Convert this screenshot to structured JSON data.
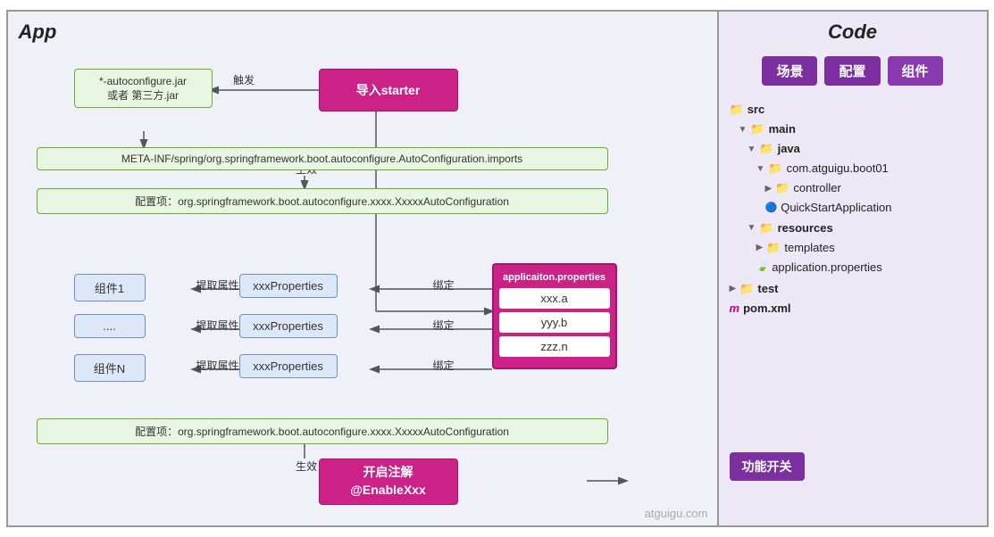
{
  "app": {
    "title": "App",
    "jar_box": "*-autoconfigure.jar\n或者 第三方.jar",
    "meta_inf": "META-INF/spring/org.springframework.boot.autoconfigure.AutoConfiguration.imports",
    "config1": "配置项：org.springframework.boot.autoconfigure.xxxx.XxxxxAutoConfiguration",
    "config2": "配置项：org.springframework.boot.autoconfigure.xxxx.XxxxxAutoConfiguration",
    "trigger": "导入starter",
    "trigger_arrow": "触发",
    "effect1": "生效",
    "effect2": "生效",
    "component1": "组件1",
    "component_dots": "....",
    "componentN": "组件N",
    "props1": "xxxProperties",
    "props2": "xxxProperties",
    "props3": "xxxProperties",
    "extract1": "提取属性",
    "extract2": "提取属性",
    "extract3": "提取属性",
    "bind1": "绑定",
    "bind2": "绑定",
    "bind3": "绑定",
    "app_properties_title": "applicaiton.properties",
    "prop_a": "xxx.a",
    "prop_b": "yyy.b",
    "prop_n": "zzz.n",
    "enable_box": "开启注解\n@EnableXxx",
    "func_btn": "功能开关"
  },
  "code": {
    "title": "Code",
    "btn_scene": "场景",
    "btn_config": "配置",
    "btn_component": "组件",
    "tree": [
      {
        "indent": 0,
        "icon": "folder",
        "label": "src"
      },
      {
        "indent": 1,
        "icon": "arrow",
        "label": ""
      },
      {
        "indent": 1,
        "icon": "folder",
        "label": "main"
      },
      {
        "indent": 2,
        "icon": "arrow",
        "label": ""
      },
      {
        "indent": 2,
        "icon": "folder",
        "label": "java"
      },
      {
        "indent": 3,
        "icon": "arrow",
        "label": ""
      },
      {
        "indent": 3,
        "icon": "folder",
        "label": "com.atguigu.boot01"
      },
      {
        "indent": 4,
        "icon": "arrow",
        "label": ""
      },
      {
        "indent": 4,
        "icon": "folder",
        "label": "controller"
      },
      {
        "indent": 4,
        "icon": "file-blue",
        "label": "QuickStartApplication"
      },
      {
        "indent": 2,
        "icon": "arrow",
        "label": ""
      },
      {
        "indent": 2,
        "icon": "folder",
        "label": "resources"
      },
      {
        "indent": 3,
        "icon": "arrow",
        "label": ""
      },
      {
        "indent": 3,
        "icon": "folder",
        "label": "templates"
      },
      {
        "indent": 3,
        "icon": "file-green",
        "label": "application.properties"
      },
      {
        "indent": 0,
        "icon": "arrow",
        "label": ""
      },
      {
        "indent": 0,
        "icon": "folder",
        "label": "test"
      },
      {
        "indent": 0,
        "icon": "file-m",
        "label": "pom.xml"
      }
    ]
  },
  "watermark": "atguigu.com"
}
